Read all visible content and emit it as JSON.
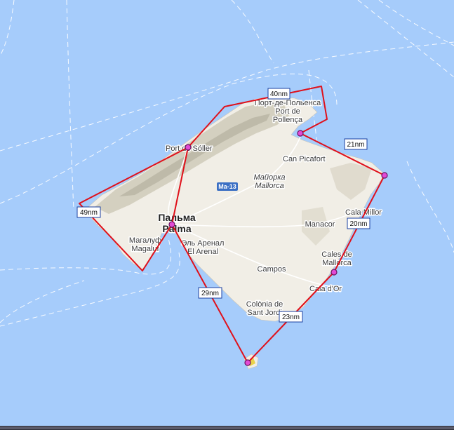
{
  "colors": {
    "sea": "#a6ccfb",
    "land": "#f1eee6",
    "route": "#e0101a",
    "waypoint": "#e24bd5"
  },
  "road": {
    "label": "Ma-13"
  },
  "places": {
    "port_pollensa_ru": "Порт-де-Польенса",
    "port_pollensa_1": "Port de",
    "port_pollensa_2": "Pollença",
    "port_soller": "Port de Sóller",
    "can_picafort": "Can Picafort",
    "mallorca_ru": "Майорка",
    "mallorca": "Mallorca",
    "palma_ru": "Пальма",
    "palma": "Palma",
    "magaluf_ru": "Магалуф",
    "magaluf": "Magaluf",
    "arenal_ru": "Эль Аренал",
    "arenal": "El Arenal",
    "manacor": "Manacor",
    "cala_millor": "Cala Millor",
    "cales_1": "Cales de",
    "cales_2": "Mallorca",
    "campos": "Campos",
    "cala_dor": "Cala d'Or",
    "colonia_1": "Colònia de",
    "colonia_2": "Sant Jordi"
  },
  "legs": [
    "40nm",
    "21nm",
    "20nm",
    "23nm",
    "29nm",
    "49nm"
  ],
  "waypoints": [
    "palma",
    "port-soller",
    "pollensa",
    "capdepera",
    "porto-colom",
    "cabrera"
  ]
}
